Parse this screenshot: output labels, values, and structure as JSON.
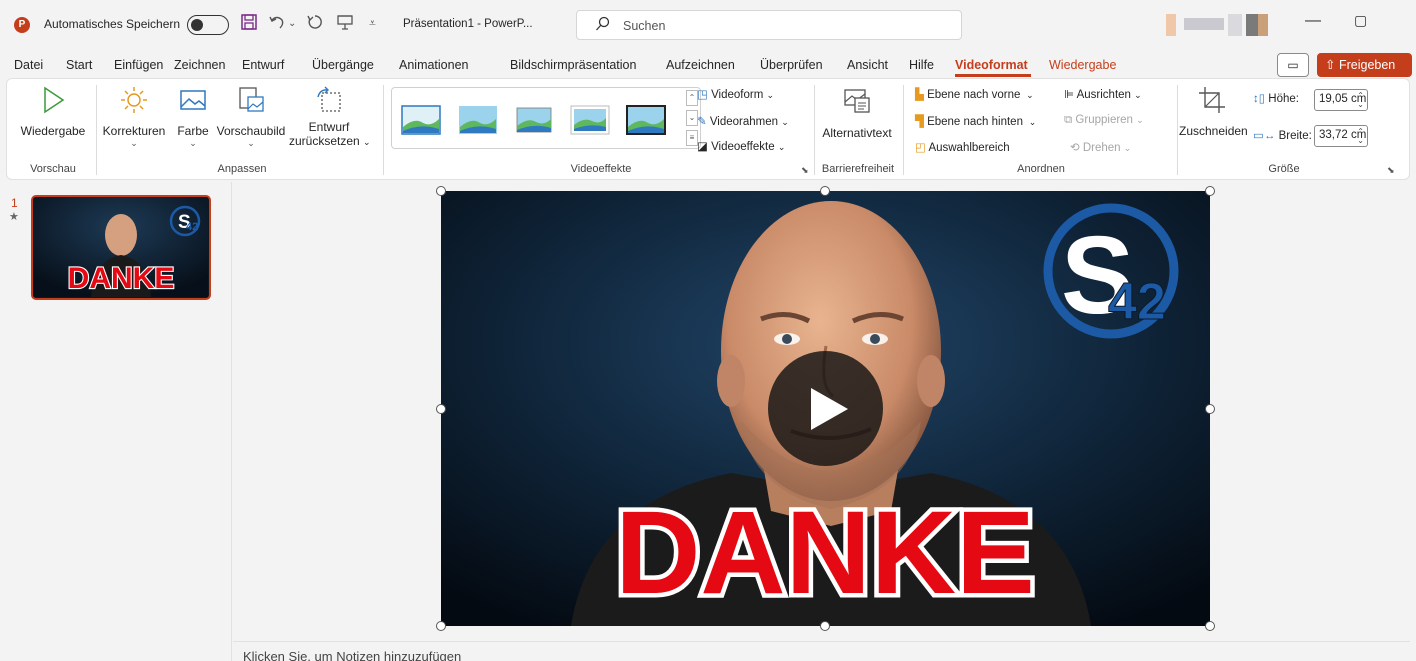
{
  "titlebar": {
    "app_logo": "P",
    "autosave_label": "Automatisches Speichern",
    "doc_title": "Präsentation1  -  PowerP...",
    "search_placeholder": "Suchen",
    "icons": [
      "save-icon",
      "undo-icon",
      "redo-icon",
      "present-icon",
      "customize-icon",
      "search-icon",
      "minimize-icon",
      "maximize-icon"
    ]
  },
  "menu": {
    "items": [
      "Datei",
      "Start",
      "Einfügen",
      "Zeichnen",
      "Entwurf",
      "Übergänge",
      "Animationen",
      "Bildschirmpräsentation",
      "Aufzeichnen",
      "Überprüfen",
      "Ansicht",
      "Hilfe",
      "Videoformat",
      "Wiedergabe"
    ],
    "active": "Videoformat",
    "share_label": "Freigeben"
  },
  "ribbon": {
    "vorschau": {
      "play_label": "Wiedergabe",
      "group_label": "Vorschau"
    },
    "anpassen": {
      "korrekturen": "Korrekturen",
      "farbe": "Farbe",
      "vorschaubild": "Vorschaubild",
      "entwurf_line1": "Entwurf",
      "entwurf_line2": "zurücksetzen",
      "group_label": "Anpassen"
    },
    "videoeffekte": {
      "videoform": "Videoform",
      "videorahmen": "Videorahmen",
      "videoeffekte": "Videoeffekte",
      "group_label": "Videoeffekte"
    },
    "barriere": {
      "alt_text": "Alternativtext",
      "group_label": "Barrierefreiheit"
    },
    "anordnen": {
      "nach_vorne": "Ebene nach vorne",
      "nach_hinten": "Ebene nach hinten",
      "auswahl": "Auswahlbereich",
      "ausrichten": "Ausrichten",
      "gruppieren": "Gruppieren",
      "drehen": "Drehen",
      "group_label": "Anordnen"
    },
    "groesse": {
      "zuschneiden": "Zuschneiden",
      "hoehe_label": "Höhe:",
      "hoehe_value": "19,05 cm",
      "breite_label": "Breite:",
      "breite_value": "33,72 cm",
      "group_label": "Größe"
    }
  },
  "slides": [
    {
      "number": "1",
      "marker": "★",
      "caption": "DANKE",
      "logo": "S42"
    }
  ],
  "video": {
    "caption": "DANKE",
    "logo": "S42"
  },
  "notes_placeholder": "Klicken Sie, um Notizen hinzuzufügen",
  "colors": {
    "accent": "#c43e1c",
    "danke_red": "#e50914",
    "logo_blue": "#1c5aa6"
  }
}
